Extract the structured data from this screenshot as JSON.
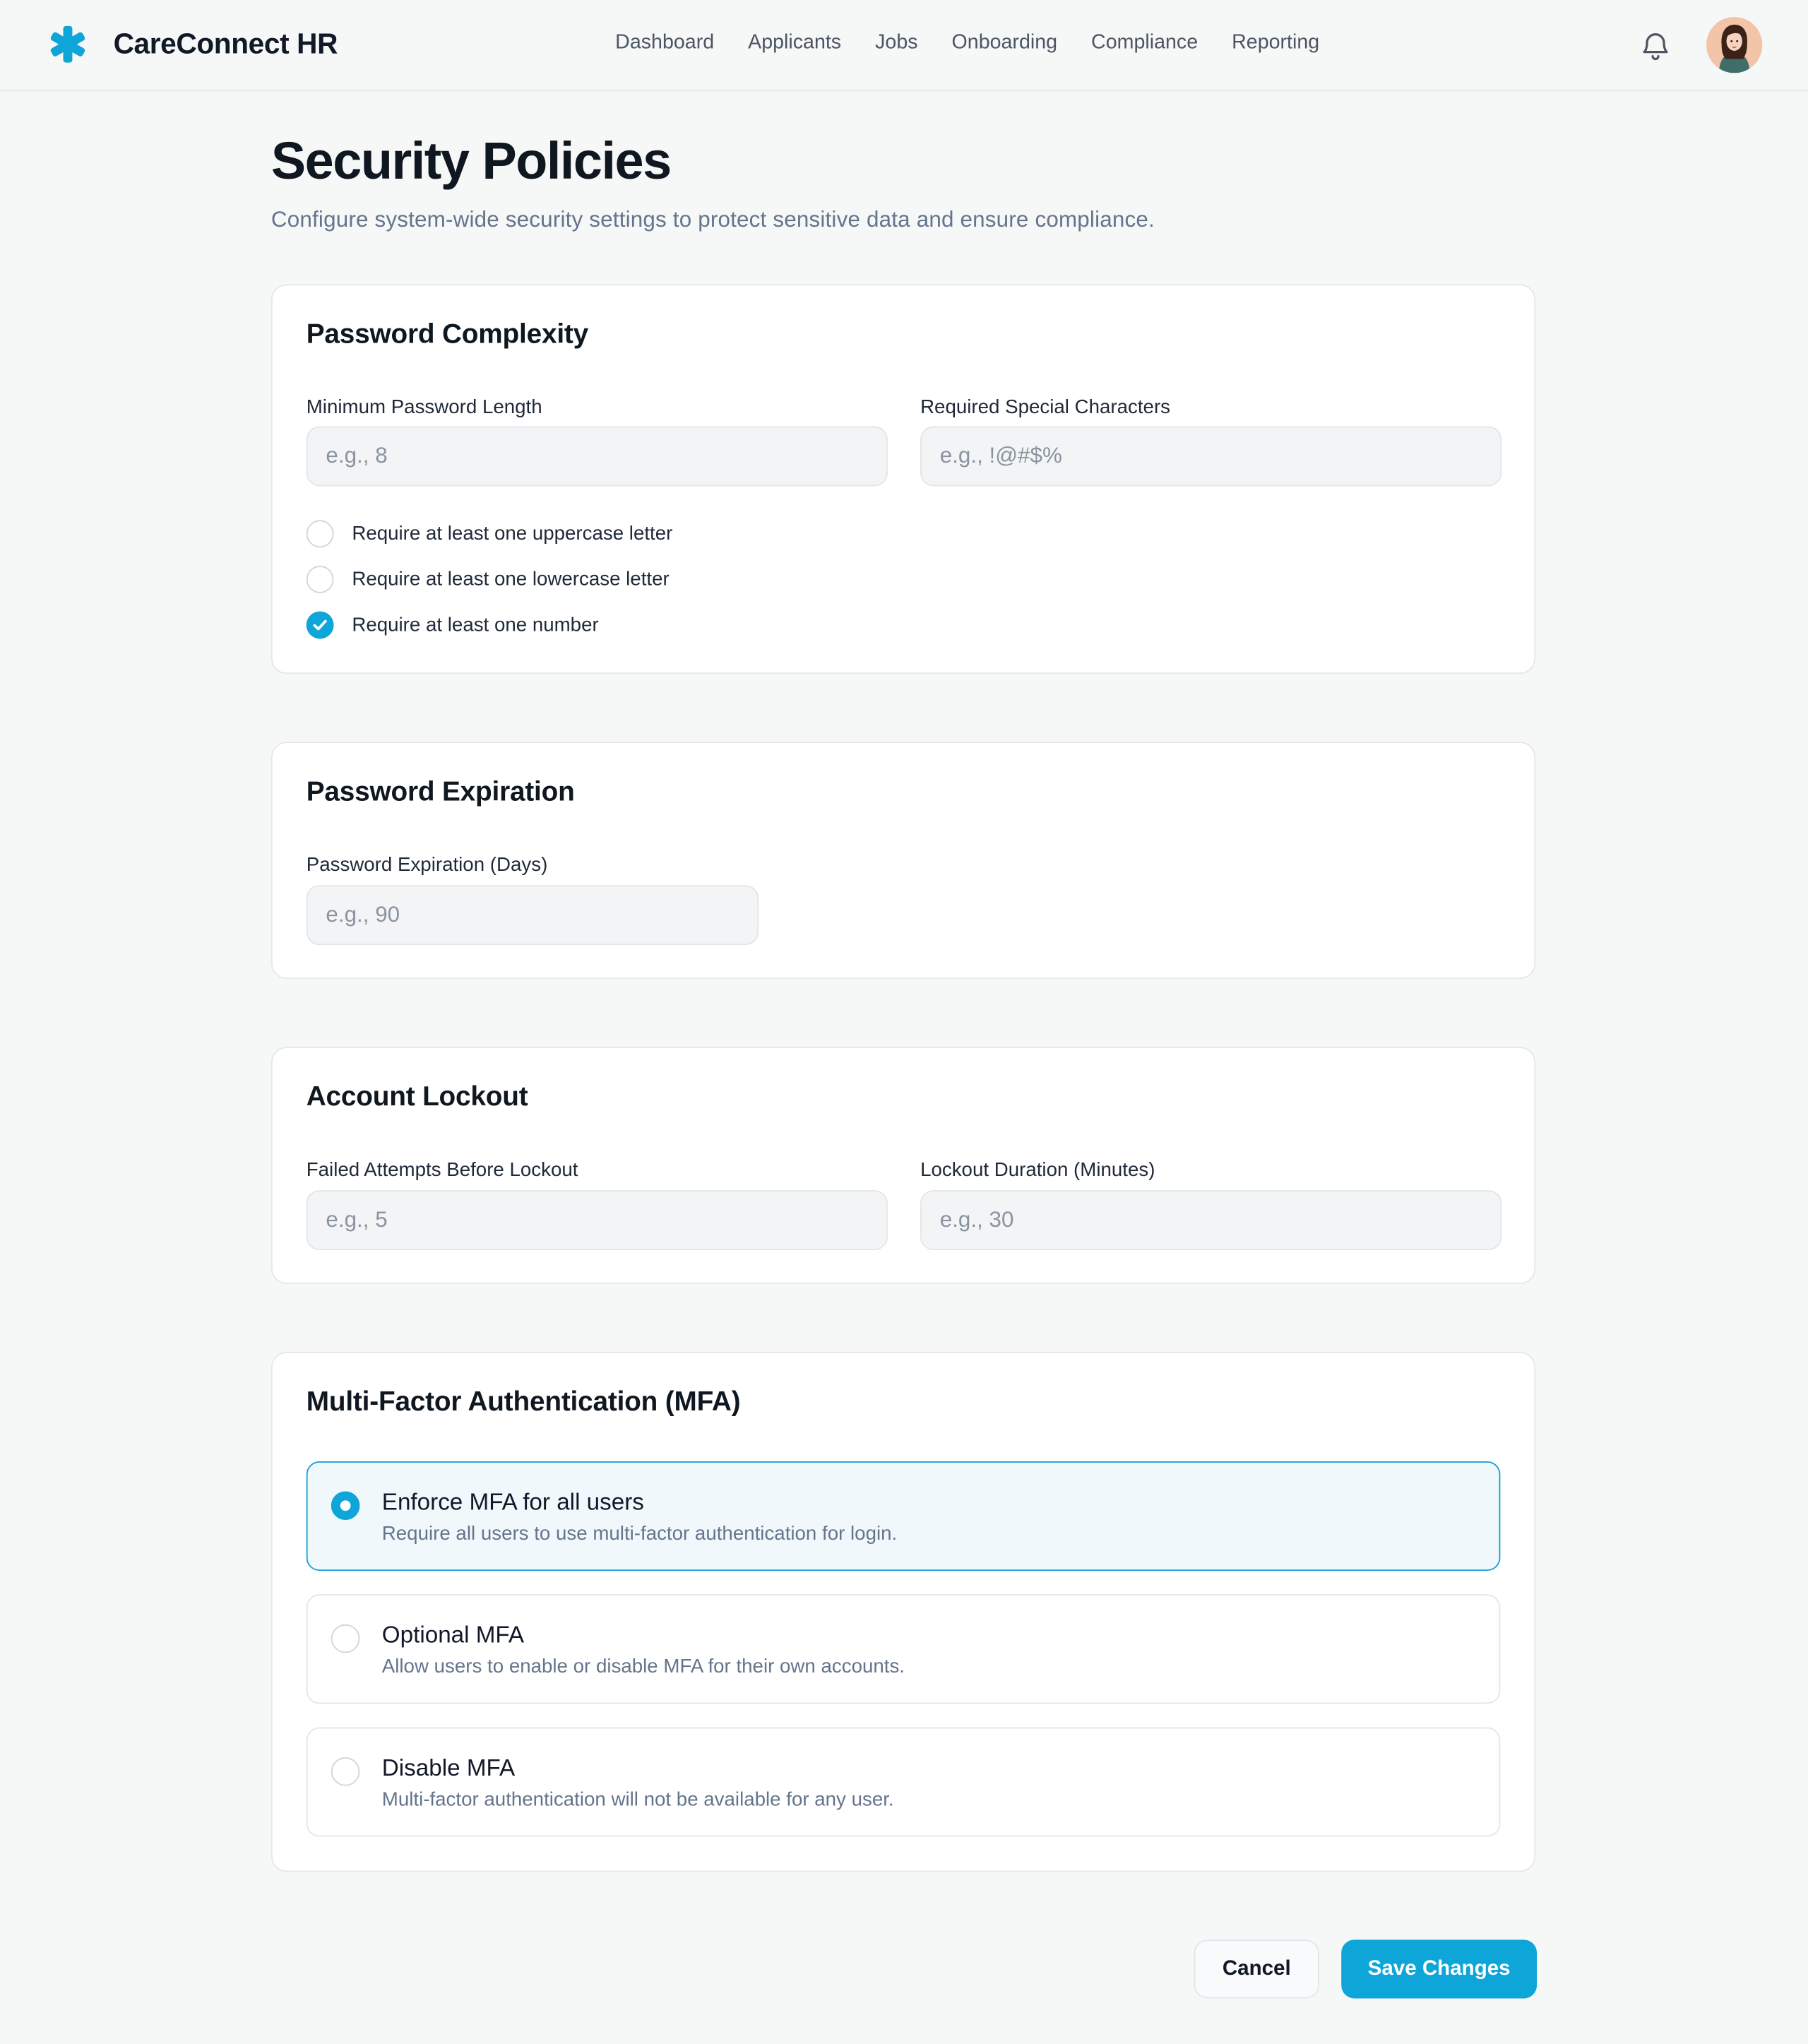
{
  "app": {
    "name": "CareConnect HR",
    "brand_color": "#0ea5d8",
    "logo_icon": "medical-asterisk-icon"
  },
  "nav": {
    "items": [
      "Dashboard",
      "Applicants",
      "Jobs",
      "Onboarding",
      "Compliance",
      "Reporting"
    ]
  },
  "header_icons": {
    "notifications": "bell-icon",
    "profile": "avatar"
  },
  "page": {
    "title": "Security Policies",
    "subtitle": "Configure system-wide security settings to protect sensitive data and ensure compliance."
  },
  "password_complexity": {
    "heading": "Password Complexity",
    "min_length": {
      "label": "Minimum Password Length",
      "placeholder": "e.g., 8",
      "value": ""
    },
    "special_chars": {
      "label": "Required Special Characters",
      "placeholder": "e.g., !@#$%",
      "value": ""
    },
    "checkboxes": [
      {
        "label": "Require at least one uppercase letter",
        "checked": false
      },
      {
        "label": "Require at least one lowercase letter",
        "checked": false
      },
      {
        "label": "Require at least one number",
        "checked": true
      }
    ]
  },
  "password_expiration": {
    "heading": "Password Expiration",
    "days": {
      "label": "Password Expiration (Days)",
      "placeholder": "e.g., 90",
      "value": ""
    }
  },
  "account_lockout": {
    "heading": "Account Lockout",
    "failed_attempts": {
      "label": "Failed Attempts Before Lockout",
      "placeholder": "e.g., 5",
      "value": ""
    },
    "duration": {
      "label": "Lockout Duration (Minutes)",
      "placeholder": "e.g., 30",
      "value": ""
    }
  },
  "mfa": {
    "heading": "Multi-Factor Authentication (MFA)",
    "options": [
      {
        "title": "Enforce MFA for all users",
        "description": "Require all users to use multi-factor authentication for login.",
        "selected": true
      },
      {
        "title": "Optional MFA",
        "description": "Allow users to enable or disable MFA for their own accounts.",
        "selected": false
      },
      {
        "title": "Disable MFA",
        "description": "Multi-factor authentication will not be available for any user.",
        "selected": false
      }
    ]
  },
  "actions": {
    "cancel": "Cancel",
    "save": "Save Changes"
  }
}
